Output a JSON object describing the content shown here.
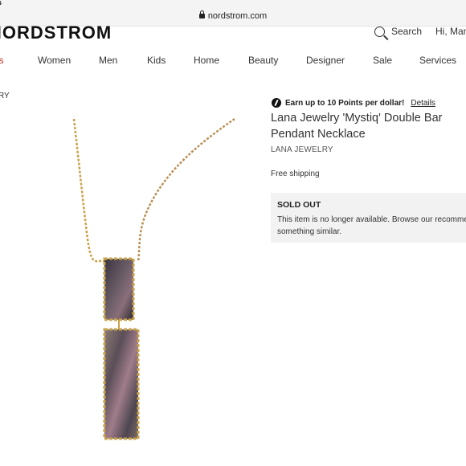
{
  "status_bar": {
    "clipped_text": "s"
  },
  "browser": {
    "url": "nordstrom.com"
  },
  "header": {
    "logo": "NORDSTROM",
    "search_label": "Search",
    "greeting": "Hi, Man"
  },
  "nav": {
    "items": [
      "fts",
      "Women",
      "Men",
      "Kids",
      "Home",
      "Beauty",
      "Designer",
      "Sale",
      "Services"
    ]
  },
  "breadcrumb": "RY",
  "product": {
    "promo_text": "Earn up to 10 Points per dollar!",
    "promo_link": "Details",
    "title": "Lana Jewelry 'Mystiq' Double Bar Pendant Necklace",
    "brand": "LANA JEWELRY",
    "shipping": "Free shipping",
    "sold_out_title": "SOLD OUT",
    "sold_out_line1": "This item is no longer available. Browse our recommen",
    "sold_out_line2": "something similar."
  },
  "colors": {
    "accent_gifts": "#c0392b",
    "gold": "#c9a24a"
  }
}
